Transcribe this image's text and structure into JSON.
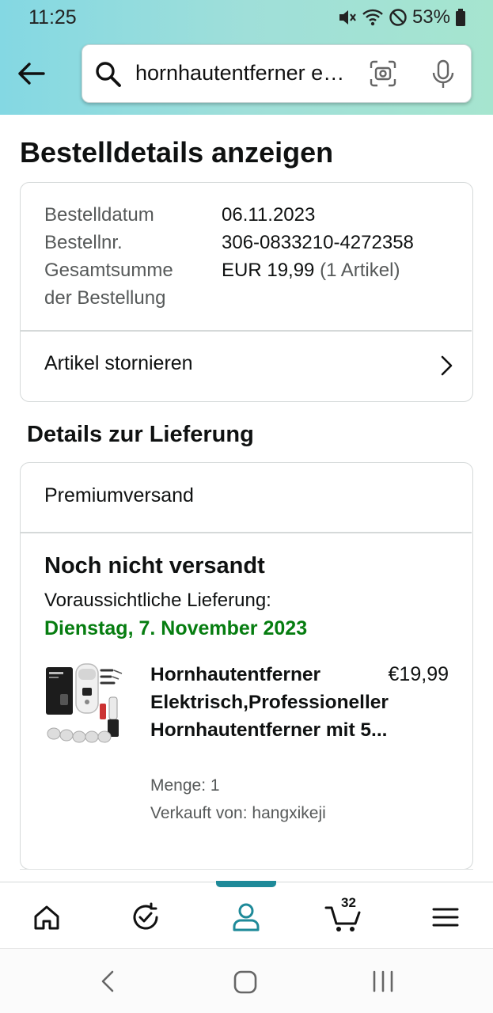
{
  "status_bar": {
    "time": "11:25",
    "battery": "53%",
    "icons": [
      "mute-icon",
      "wifi-icon",
      "do-not-disturb-icon",
      "battery-icon"
    ]
  },
  "header": {
    "back_icon": "arrow-left-icon",
    "search": {
      "value": "hornhautentferner elektrisch",
      "icons": [
        "search-icon",
        "camera-scan-icon",
        "microphone-icon"
      ]
    }
  },
  "page": {
    "title": "Bestelldetails anzeigen"
  },
  "order_summary": {
    "rows": [
      {
        "label": "Bestelldatum",
        "value": "06.11.2023"
      },
      {
        "label": "Bestellnr.",
        "value": "306-0833210-4272358"
      },
      {
        "label": "Gesamtsumme der Bestellung",
        "value": "EUR 19,99",
        "extra": "(1 Artikel)"
      }
    ],
    "cancel_label": "Artikel stornieren"
  },
  "delivery": {
    "section_title": "Details zur Lieferung",
    "shipping_method": "Premiumversand",
    "status": "Noch nicht versandt",
    "expected_label": "Voraussichtliche Lieferung:",
    "expected_date": "Dienstag, 7. November 2023",
    "item": {
      "title": "Hornhautentferner Elektrisch,Professioneller Hornhautentferner mit 5...",
      "price": "€19,99",
      "quantity": "Menge: 1",
      "seller": "Verkauft von: hangxikeji"
    }
  },
  "bottom_nav": {
    "items": [
      "home-icon",
      "refresh-check-icon",
      "account-icon",
      "cart-icon",
      "menu-icon"
    ],
    "active": "account-icon",
    "cart_count": "32"
  },
  "colors": {
    "accent": "#1e8a99",
    "delivery_green": "#067d10",
    "muted_text": "#565959",
    "border": "#d5d9d9"
  }
}
